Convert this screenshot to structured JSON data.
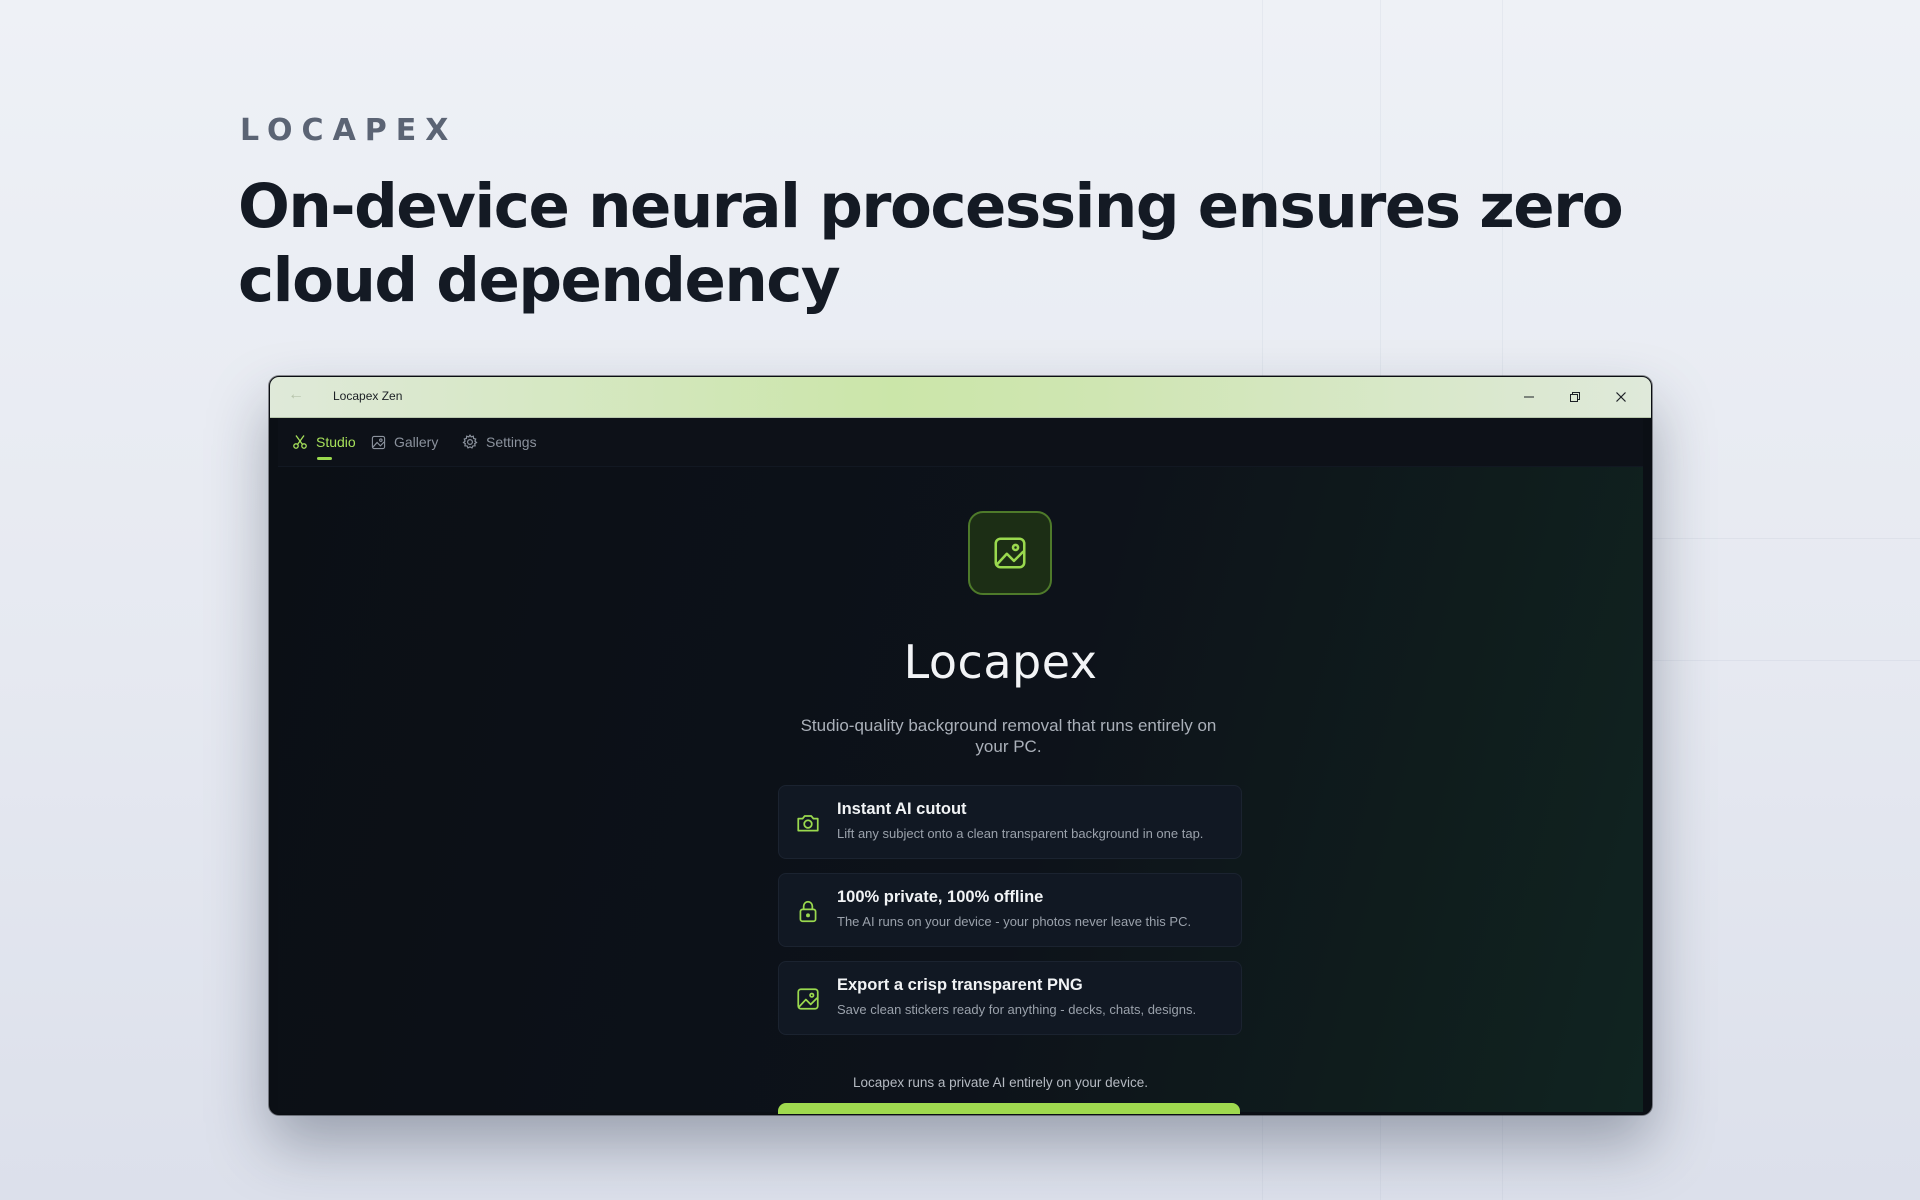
{
  "hero": {
    "brand": "LOCAPEX",
    "headline": "On-device neural processing ensures zero cloud dependency"
  },
  "window": {
    "title": "Locapex Zen",
    "controls": [
      "minimize-icon",
      "restore-icon",
      "close-icon"
    ]
  },
  "nav": {
    "items": [
      {
        "label": "Studio",
        "icon": "scissors-icon",
        "active": true
      },
      {
        "label": "Gallery",
        "icon": "image-icon",
        "active": false
      },
      {
        "label": "Settings",
        "icon": "gear-icon",
        "active": false
      }
    ]
  },
  "main": {
    "app_name": "Locapex",
    "tagline": "Studio-quality background removal that runs entirely on your PC.",
    "features": [
      {
        "title": "Instant AI cutout",
        "description": "Lift any subject onto a clean transparent background in one tap.",
        "icon": "camera-icon"
      },
      {
        "title": "100% private, 100% offline",
        "description": "The AI runs on your device - your photos never leave this PC.",
        "icon": "lock-icon"
      },
      {
        "title": "Export a crisp transparent PNG",
        "description": "Save clean stickers ready for anything - decks, chats, designs.",
        "icon": "image-icon"
      }
    ],
    "footnote": "Locapex runs a private AI entirely on your device."
  },
  "colors": {
    "accent": "#9ad94e",
    "background": "#0b0f15",
    "page_background": "#eef1f6"
  }
}
